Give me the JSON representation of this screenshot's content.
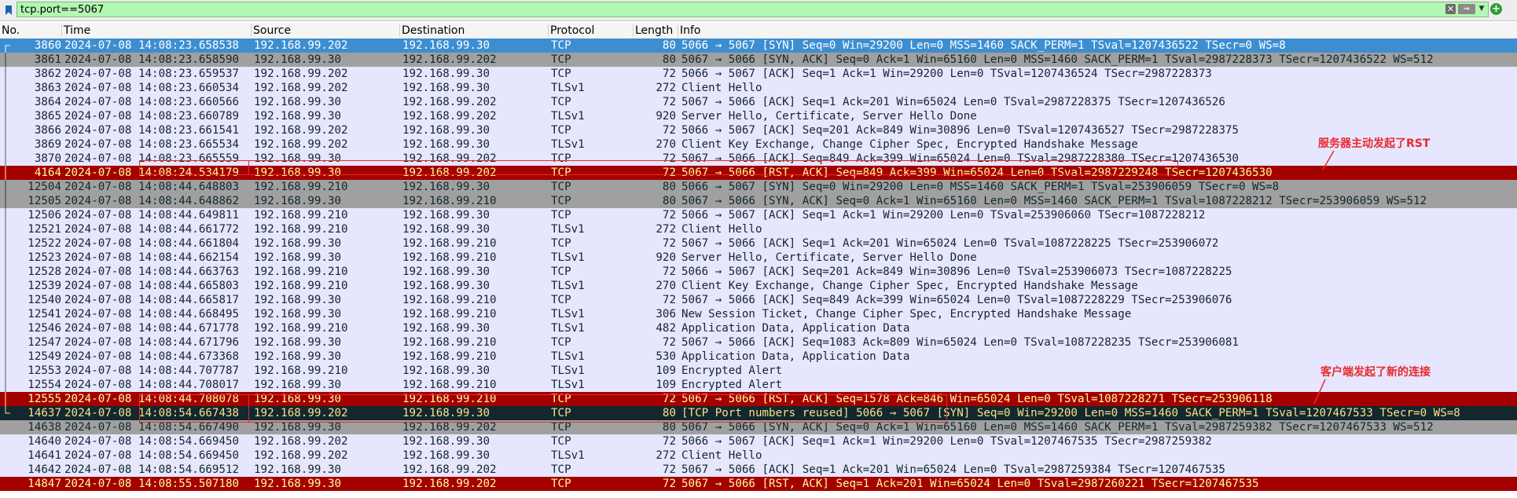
{
  "filter": {
    "value": "tcp.port==5067",
    "icons": {
      "bookmark": "bookmark-icon",
      "clear": "clear-icon",
      "apply": "arrow-right-icon",
      "dropdown": "chevron-down-icon",
      "add": "plus-icon"
    }
  },
  "columns": {
    "no": "No.",
    "time": "Time",
    "source": "Source",
    "destination": "Destination",
    "protocol": "Protocol",
    "length": "Length",
    "info": "Info"
  },
  "colors": {
    "selected": "#3d8ed1",
    "tcp": "#e7e6ff",
    "syn_ack": "#a0a0a0",
    "rst": "#a40000",
    "bad": "#12272e",
    "annotation": "#e8292d"
  },
  "packets": [
    {
      "no": "3860",
      "time": "2024-07-08 14:08:23.658538",
      "src": "192.168.99.202",
      "dst": "192.168.99.30",
      "proto": "TCP",
      "len": "80",
      "info": "5066 → 5067 [SYN] Seq=0 Win=29200 Len=0 MSS=1460 SACK_PERM=1 TSval=1207436522 TSecr=0 WS=8",
      "style": "blue",
      "tree": "start"
    },
    {
      "no": "3861",
      "time": "2024-07-08 14:08:23.658590",
      "src": "192.168.99.30",
      "dst": "192.168.99.202",
      "proto": "TCP",
      "len": "80",
      "info": "5067 → 5066 [SYN, ACK] Seq=0 Ack=1 Win=65160 Len=0 MSS=1460 SACK_PERM=1 TSval=2987228373 TSecr=1207436522 WS=512",
      "style": "gray",
      "tree": "mid"
    },
    {
      "no": "3862",
      "time": "2024-07-08 14:08:23.659537",
      "src": "192.168.99.202",
      "dst": "192.168.99.30",
      "proto": "TCP",
      "len": "72",
      "info": "5066 → 5067 [ACK] Seq=1 Ack=1 Win=29200 Len=0 TSval=1207436524 TSecr=2987228373",
      "style": "lav",
      "tree": "mid"
    },
    {
      "no": "3863",
      "time": "2024-07-08 14:08:23.660534",
      "src": "192.168.99.202",
      "dst": "192.168.99.30",
      "proto": "TLSv1",
      "len": "272",
      "info": "Client Hello",
      "style": "lav",
      "tree": "mid"
    },
    {
      "no": "3864",
      "time": "2024-07-08 14:08:23.660566",
      "src": "192.168.99.30",
      "dst": "192.168.99.202",
      "proto": "TCP",
      "len": "72",
      "info": "5067 → 5066 [ACK] Seq=1 Ack=201 Win=65024 Len=0 TSval=2987228375 TSecr=1207436526",
      "style": "lav",
      "tree": "mid"
    },
    {
      "no": "3865",
      "time": "2024-07-08 14:08:23.660789",
      "src": "192.168.99.30",
      "dst": "192.168.99.202",
      "proto": "TLSv1",
      "len": "920",
      "info": "Server Hello, Certificate, Server Hello Done",
      "style": "lav",
      "tree": "mid"
    },
    {
      "no": "3866",
      "time": "2024-07-08 14:08:23.661541",
      "src": "192.168.99.202",
      "dst": "192.168.99.30",
      "proto": "TCP",
      "len": "72",
      "info": "5066 → 5067 [ACK] Seq=201 Ack=849 Win=30896 Len=0 TSval=1207436527 TSecr=2987228375",
      "style": "lav",
      "tree": "mid"
    },
    {
      "no": "3869",
      "time": "2024-07-08 14:08:23.665534",
      "src": "192.168.99.202",
      "dst": "192.168.99.30",
      "proto": "TLSv1",
      "len": "270",
      "info": "Client Key Exchange, Change Cipher Spec, Encrypted Handshake Message",
      "style": "lav",
      "tree": "mid"
    },
    {
      "no": "3870",
      "time": "2024-07-08 14:08:23.665559",
      "src": "192.168.99.30",
      "dst": "192.168.99.202",
      "proto": "TCP",
      "len": "72",
      "info": "5067 → 5066 [ACK] Seq=849 Ack=399 Win=65024 Len=0 TSval=2987228380 TSecr=1207436530",
      "style": "lav",
      "tree": "mid"
    },
    {
      "no": "4164",
      "time": "2024-07-08 14:08:24.534179",
      "src": "192.168.99.30",
      "dst": "192.168.99.202",
      "proto": "TCP",
      "len": "72",
      "info": "5067 → 5066 [RST, ACK] Seq=849 Ack=399 Win=65024 Len=0 TSval=2987229248 TSecr=1207436530",
      "style": "red",
      "tree": "mid"
    },
    {
      "no": "12504",
      "time": "2024-07-08 14:08:44.648803",
      "src": "192.168.99.210",
      "dst": "192.168.99.30",
      "proto": "TCP",
      "len": "80",
      "info": "5066 → 5067 [SYN] Seq=0 Win=29200 Len=0 MSS=1460 SACK_PERM=1 TSval=253906059 TSecr=0 WS=8",
      "style": "gray",
      "tree": "mid"
    },
    {
      "no": "12505",
      "time": "2024-07-08 14:08:44.648862",
      "src": "192.168.99.30",
      "dst": "192.168.99.210",
      "proto": "TCP",
      "len": "80",
      "info": "5067 → 5066 [SYN, ACK] Seq=0 Ack=1 Win=65160 Len=0 MSS=1460 SACK_PERM=1 TSval=1087228212 TSecr=253906059 WS=512",
      "style": "gray",
      "tree": "mid"
    },
    {
      "no": "12506",
      "time": "2024-07-08 14:08:44.649811",
      "src": "192.168.99.210",
      "dst": "192.168.99.30",
      "proto": "TCP",
      "len": "72",
      "info": "5066 → 5067 [ACK] Seq=1 Ack=1 Win=29200 Len=0 TSval=253906060 TSecr=1087228212",
      "style": "lav",
      "tree": "mid"
    },
    {
      "no": "12521",
      "time": "2024-07-08 14:08:44.661772",
      "src": "192.168.99.210",
      "dst": "192.168.99.30",
      "proto": "TLSv1",
      "len": "272",
      "info": "Client Hello",
      "style": "lav",
      "tree": "mid"
    },
    {
      "no": "12522",
      "time": "2024-07-08 14:08:44.661804",
      "src": "192.168.99.30",
      "dst": "192.168.99.210",
      "proto": "TCP",
      "len": "72",
      "info": "5067 → 5066 [ACK] Seq=1 Ack=201 Win=65024 Len=0 TSval=1087228225 TSecr=253906072",
      "style": "lav",
      "tree": "mid"
    },
    {
      "no": "12523",
      "time": "2024-07-08 14:08:44.662154",
      "src": "192.168.99.30",
      "dst": "192.168.99.210",
      "proto": "TLSv1",
      "len": "920",
      "info": "Server Hello, Certificate, Server Hello Done",
      "style": "lav",
      "tree": "mid"
    },
    {
      "no": "12528",
      "time": "2024-07-08 14:08:44.663763",
      "src": "192.168.99.210",
      "dst": "192.168.99.30",
      "proto": "TCP",
      "len": "72",
      "info": "5066 → 5067 [ACK] Seq=201 Ack=849 Win=30896 Len=0 TSval=253906073 TSecr=1087228225",
      "style": "lav",
      "tree": "mid"
    },
    {
      "no": "12539",
      "time": "2024-07-08 14:08:44.665803",
      "src": "192.168.99.210",
      "dst": "192.168.99.30",
      "proto": "TLSv1",
      "len": "270",
      "info": "Client Key Exchange, Change Cipher Spec, Encrypted Handshake Message",
      "style": "lav",
      "tree": "mid"
    },
    {
      "no": "12540",
      "time": "2024-07-08 14:08:44.665817",
      "src": "192.168.99.30",
      "dst": "192.168.99.210",
      "proto": "TCP",
      "len": "72",
      "info": "5067 → 5066 [ACK] Seq=849 Ack=399 Win=65024 Len=0 TSval=1087228229 TSecr=253906076",
      "style": "lav",
      "tree": "mid"
    },
    {
      "no": "12541",
      "time": "2024-07-08 14:08:44.668495",
      "src": "192.168.99.30",
      "dst": "192.168.99.210",
      "proto": "TLSv1",
      "len": "306",
      "info": "New Session Ticket, Change Cipher Spec, Encrypted Handshake Message",
      "style": "lav",
      "tree": "mid"
    },
    {
      "no": "12546",
      "time": "2024-07-08 14:08:44.671778",
      "src": "192.168.99.210",
      "dst": "192.168.99.30",
      "proto": "TLSv1",
      "len": "482",
      "info": "Application Data, Application Data",
      "style": "lav",
      "tree": "mid"
    },
    {
      "no": "12547",
      "time": "2024-07-08 14:08:44.671796",
      "src": "192.168.99.30",
      "dst": "192.168.99.210",
      "proto": "TCP",
      "len": "72",
      "info": "5067 → 5066 [ACK] Seq=1083 Ack=809 Win=65024 Len=0 TSval=1087228235 TSecr=253906081",
      "style": "lav",
      "tree": "mid"
    },
    {
      "no": "12549",
      "time": "2024-07-08 14:08:44.673368",
      "src": "192.168.99.30",
      "dst": "192.168.99.210",
      "proto": "TLSv1",
      "len": "530",
      "info": "Application Data, Application Data",
      "style": "lav",
      "tree": "mid"
    },
    {
      "no": "12553",
      "time": "2024-07-08 14:08:44.707787",
      "src": "192.168.99.210",
      "dst": "192.168.99.30",
      "proto": "TLSv1",
      "len": "109",
      "info": "Encrypted Alert",
      "style": "lav",
      "tree": "mid"
    },
    {
      "no": "12554",
      "time": "2024-07-08 14:08:44.708017",
      "src": "192.168.99.30",
      "dst": "192.168.99.210",
      "proto": "TLSv1",
      "len": "109",
      "info": "Encrypted Alert",
      "style": "lav",
      "tree": "mid"
    },
    {
      "no": "12555",
      "time": "2024-07-08 14:08:44.708078",
      "src": "192.168.99.30",
      "dst": "192.168.99.210",
      "proto": "TCP",
      "len": "72",
      "info": "5067 → 5066 [RST, ACK] Seq=1578 Ack=846 Win=65024 Len=0 TSval=1087228271 TSecr=253906118",
      "style": "red",
      "tree": "mid"
    },
    {
      "no": "14637",
      "time": "2024-07-08 14:08:54.667438",
      "src": "192.168.99.202",
      "dst": "192.168.99.30",
      "proto": "TCP",
      "len": "80",
      "info": "[TCP Port numbers reused] 5066 → 5067 [SYN] Seq=0 Win=29200 Len=0 MSS=1460 SACK_PERM=1 TSval=1207467533 TSecr=0 WS=8",
      "style": "dark",
      "tree": "end"
    },
    {
      "no": "14638",
      "time": "2024-07-08 14:08:54.667490",
      "src": "192.168.99.30",
      "dst": "192.168.99.202",
      "proto": "TCP",
      "len": "80",
      "info": "5067 → 5066 [SYN, ACK] Seq=0 Ack=1 Win=65160 Len=0 MSS=1460 SACK_PERM=1 TSval=2987259382 TSecr=1207467533 WS=512",
      "style": "gray",
      "tree": ""
    },
    {
      "no": "14640",
      "time": "2024-07-08 14:08:54.669450",
      "src": "192.168.99.202",
      "dst": "192.168.99.30",
      "proto": "TCP",
      "len": "72",
      "info": "5066 → 5067 [ACK] Seq=1 Ack=1 Win=29200 Len=0 TSval=1207467535 TSecr=2987259382",
      "style": "lav",
      "tree": ""
    },
    {
      "no": "14641",
      "time": "2024-07-08 14:08:54.669450",
      "src": "192.168.99.202",
      "dst": "192.168.99.30",
      "proto": "TLSv1",
      "len": "272",
      "info": "Client Hello",
      "style": "lav",
      "tree": ""
    },
    {
      "no": "14642",
      "time": "2024-07-08 14:08:54.669512",
      "src": "192.168.99.30",
      "dst": "192.168.99.202",
      "proto": "TCP",
      "len": "72",
      "info": "5067 → 5066 [ACK] Seq=1 Ack=201 Win=65024 Len=0 TSval=2987259384 TSecr=1207467535",
      "style": "lav",
      "tree": ""
    },
    {
      "no": "14847",
      "time": "2024-07-08 14:08:55.507180",
      "src": "192.168.99.30",
      "dst": "192.168.99.202",
      "proto": "TCP",
      "len": "72",
      "info": "5067 → 5066 [RST, ACK] Seq=1 Ack=201 Win=65024 Len=0 TSval=2987260221 TSecr=1207467535",
      "style": "red",
      "tree": ""
    }
  ],
  "annotations": {
    "server_rst": "服务器主动发起了RST",
    "client_new": "客户端发起了新的连接"
  }
}
